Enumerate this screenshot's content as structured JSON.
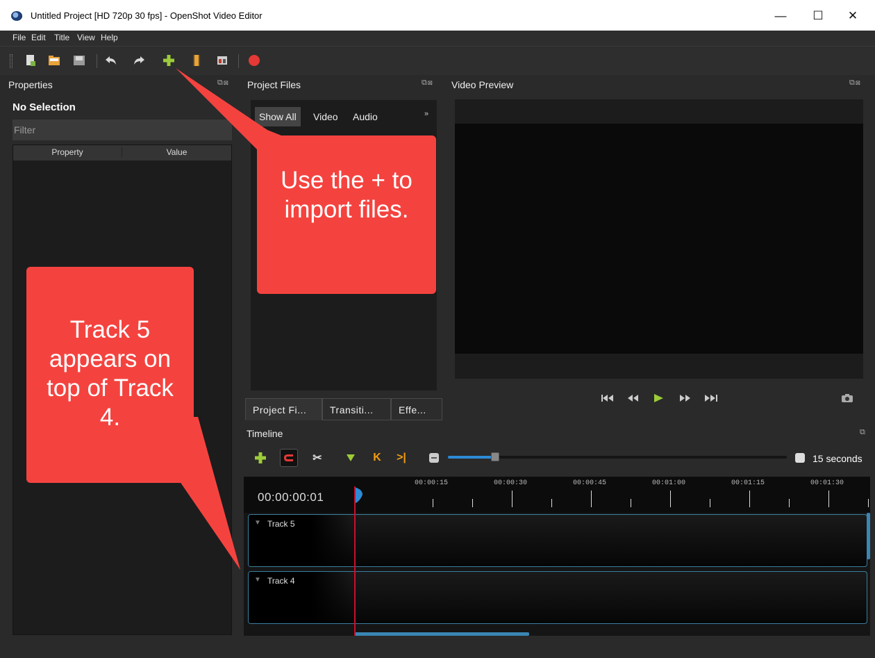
{
  "window": {
    "title": "Untitled Project [HD 720p 30 fps] - OpenShot Video Editor",
    "minimize": "—",
    "maximize": "☐",
    "close": "✕"
  },
  "menu": [
    "File",
    "Edit",
    "Title",
    "View",
    "Help"
  ],
  "toolbar": {
    "icons": [
      "new-project-icon",
      "open-project-icon",
      "save-project-icon",
      "undo-icon",
      "redo-icon",
      "import-files-icon",
      "choose-profile-icon",
      "fullscreen-icon",
      "export-video-icon"
    ],
    "accent_green": "#9ccc3a",
    "record_red": "#e53935"
  },
  "properties": {
    "title": "Properties",
    "selection": "No Selection",
    "filter_placeholder": "Filter",
    "columns": [
      "Property",
      "Value"
    ]
  },
  "project_files": {
    "title": "Project Files",
    "filters": [
      "Show All",
      "Video",
      "Audio"
    ],
    "more": "»"
  },
  "bottom_tabs": [
    "Project Fi...",
    "Transiti...",
    "Effe..."
  ],
  "video_preview": {
    "title": "Video Preview"
  },
  "timeline": {
    "title": "Timeline",
    "timecode": "00:00:00:01",
    "zoom_label": "15 seconds",
    "zoom_level": 0.14,
    "ticks": [
      "00:00:15",
      "00:00:30",
      "00:00:45",
      "00:01:00",
      "00:01:15",
      "00:01:30"
    ],
    "tracks": [
      "Track 5",
      "Track 4"
    ]
  },
  "callouts": {
    "import": "Use the + to import files.",
    "track": "Track 5 appears on top of Track 4."
  },
  "colors": {
    "callout": "#f4433f",
    "playhead": "#c8102e",
    "accent_blue": "#2d8bd6"
  }
}
